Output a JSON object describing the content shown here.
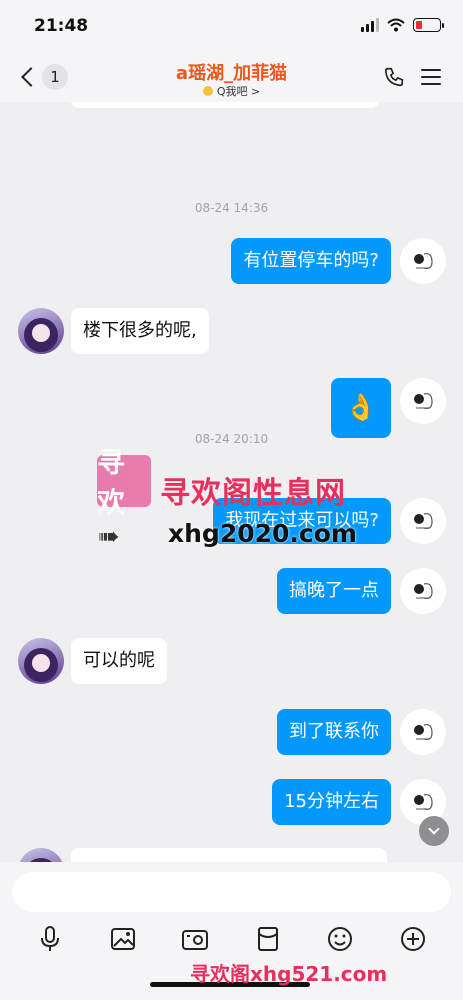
{
  "status_bar": {
    "time": "21:48"
  },
  "header": {
    "back_count": "1",
    "title": "a瑶湖_加菲猫",
    "subtitle": "Q我吧 >"
  },
  "chat": {
    "timestamps": [
      "08-24 14:36",
      "08-24 20:10"
    ],
    "messages": [
      {
        "side": "out",
        "text": "有位置停车的吗?"
      },
      {
        "side": "in",
        "text": "楼下很多的呢,"
      },
      {
        "side": "out",
        "text": "👌"
      },
      {
        "side": "out",
        "text": "我现在过来可以吗?"
      },
      {
        "side": "out",
        "text": "搞晚了一点"
      },
      {
        "side": "in",
        "text": "可以的呢"
      },
      {
        "side": "out",
        "text": "到了联系你"
      },
      {
        "side": "out",
        "text": "15分钟左右"
      }
    ]
  },
  "watermark": {
    "logo_text": "寻欢",
    "line1": "寻欢阁性息网",
    "line2": "xhg2020.com",
    "bottom": "寻欢阁xhg521.com"
  },
  "input": {
    "placeholder": ""
  },
  "icons": [
    "mic-icon",
    "image-icon",
    "camera-icon",
    "red-packet-icon",
    "emoji-icon",
    "plus-icon"
  ]
}
